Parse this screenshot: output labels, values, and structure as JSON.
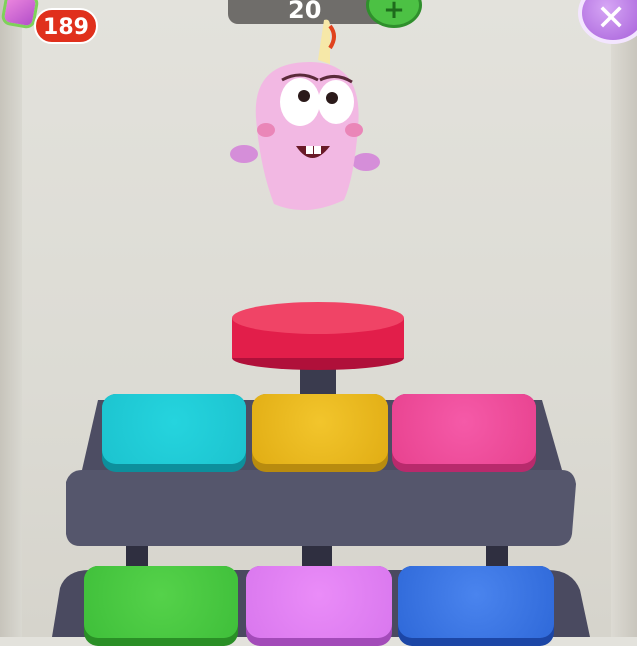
{
  "hud": {
    "gem_count": "189",
    "counter_value": "20",
    "plus_label": "+",
    "close_label": "✕"
  },
  "icons": {
    "gem": "gem-icon",
    "plus": "plus-icon",
    "close": "close-icon"
  },
  "pads": {
    "top_row": [
      {
        "color_name": "cyan",
        "color": "#1cc3cf"
      },
      {
        "color_name": "yellow",
        "color": "#e8b91f"
      },
      {
        "color_name": "pink",
        "color": "#ec4d9a"
      }
    ],
    "bottom_row": [
      {
        "color_name": "green",
        "color": "#3fbf3a"
      },
      {
        "color_name": "violet",
        "color": "#d977ee"
      },
      {
        "color_name": "blue",
        "color": "#2f69d9"
      }
    ]
  },
  "center_button": {
    "color": "#e21e4a"
  },
  "colors": {
    "machine_body": "#4d4d63",
    "character": "#f2b8e3"
  }
}
